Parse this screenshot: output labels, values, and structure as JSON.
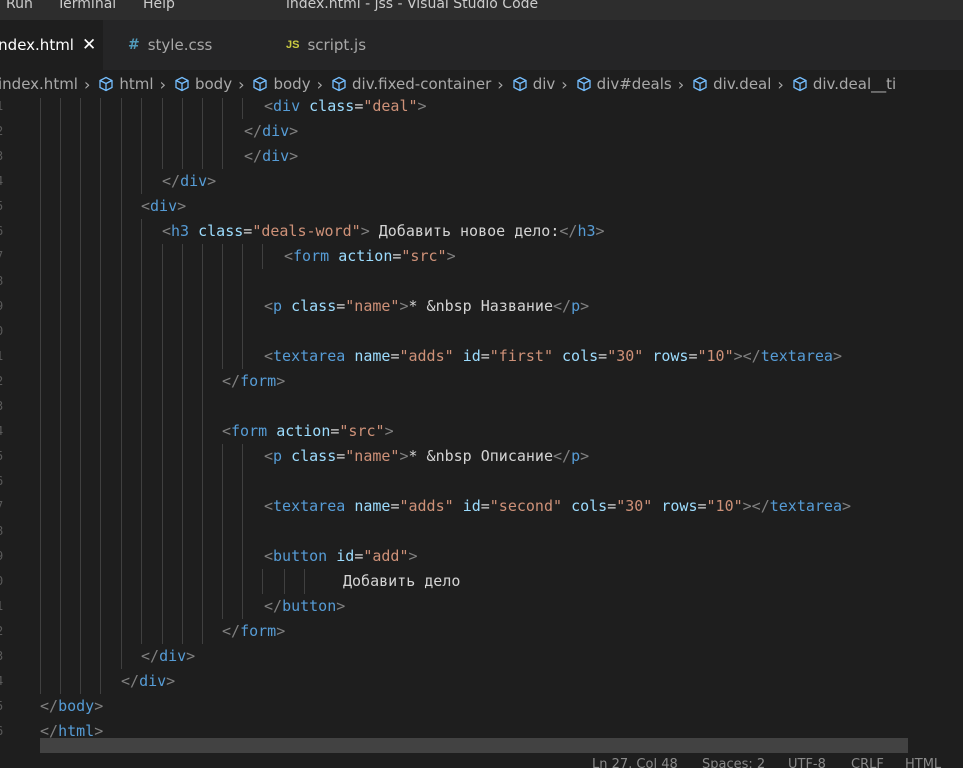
{
  "menu": {
    "run": "Run",
    "terminal": "Terminal",
    "help": "Help"
  },
  "window_title": "index.html - jss - Visual Studio Code",
  "tabs": [
    {
      "label": "index.html",
      "icon": "html-icon",
      "active": true
    },
    {
      "label": "style.css",
      "icon": "css-icon",
      "icon_text": "#"
    },
    {
      "label": "script.js",
      "icon": "js-icon",
      "icon_text": "JS"
    }
  ],
  "breadcrumb": [
    "index.html",
    "html",
    "body",
    "body",
    "div.fixed-container",
    "div",
    "div#deals",
    "div.deal",
    "div.deal__ti"
  ],
  "code": {
    "line_numbers": [
      "1",
      "2",
      "3",
      "4",
      "5",
      "6",
      "7",
      "8",
      "9",
      "0",
      "1",
      "2",
      "3",
      "4",
      "5",
      "6",
      "7",
      "8",
      "9",
      "0",
      "1",
      "2",
      "3",
      "4",
      "5",
      "6"
    ],
    "lines": [
      [
        [
          "p",
          "<"
        ],
        [
          "t",
          "div"
        ],
        [
          "x",
          " "
        ],
        [
          "a",
          "class"
        ],
        [
          "x",
          "="
        ],
        [
          "s",
          "\"deal\""
        ],
        [
          "p",
          ">"
        ]
      ],
      [
        [
          "p",
          "</"
        ],
        [
          "t",
          "div"
        ],
        [
          "p",
          ">"
        ]
      ],
      [
        [
          "p",
          "</"
        ],
        [
          "t",
          "div"
        ],
        [
          "p",
          ">"
        ]
      ],
      [
        [
          "p",
          "</"
        ],
        [
          "t",
          "div"
        ],
        [
          "p",
          ">"
        ]
      ],
      [
        [
          "p",
          "<"
        ],
        [
          "t",
          "div"
        ],
        [
          "p",
          ">"
        ]
      ],
      [
        [
          "p",
          "<"
        ],
        [
          "t",
          "h3"
        ],
        [
          "x",
          " "
        ],
        [
          "a",
          "class"
        ],
        [
          "x",
          "="
        ],
        [
          "s",
          "\"deals-word\""
        ],
        [
          "p",
          ">"
        ],
        [
          "x",
          " Добавить новое дело:"
        ],
        [
          "p",
          "</"
        ],
        [
          "t",
          "h3"
        ],
        [
          "p",
          ">"
        ]
      ],
      [
        [
          "p",
          "<"
        ],
        [
          "t",
          "form"
        ],
        [
          "x",
          " "
        ],
        [
          "a",
          "action"
        ],
        [
          "x",
          "="
        ],
        [
          "s",
          "\"src\""
        ],
        [
          "p",
          ">"
        ]
      ],
      [],
      [
        [
          "p",
          "<"
        ],
        [
          "t",
          "p"
        ],
        [
          "x",
          " "
        ],
        [
          "a",
          "class"
        ],
        [
          "x",
          "="
        ],
        [
          "s",
          "\"name\""
        ],
        [
          "p",
          ">"
        ],
        [
          "x",
          "* &nbsp Название"
        ],
        [
          "p",
          "</"
        ],
        [
          "t",
          "p"
        ],
        [
          "p",
          ">"
        ]
      ],
      [],
      [
        [
          "p",
          "<"
        ],
        [
          "t",
          "textarea"
        ],
        [
          "x",
          " "
        ],
        [
          "a",
          "name"
        ],
        [
          "x",
          "="
        ],
        [
          "s",
          "\"adds\""
        ],
        [
          "x",
          " "
        ],
        [
          "a",
          "id"
        ],
        [
          "x",
          "="
        ],
        [
          "s",
          "\"first\""
        ],
        [
          "x",
          " "
        ],
        [
          "a",
          "cols"
        ],
        [
          "x",
          "="
        ],
        [
          "s",
          "\"30\""
        ],
        [
          "x",
          " "
        ],
        [
          "a",
          "rows"
        ],
        [
          "x",
          "="
        ],
        [
          "s",
          "\"10\""
        ],
        [
          "p",
          "></"
        ],
        [
          "t",
          "textarea"
        ],
        [
          "p",
          ">"
        ]
      ],
      [
        [
          "p",
          "</"
        ],
        [
          "t",
          "form"
        ],
        [
          "p",
          ">"
        ]
      ],
      [],
      [
        [
          "p",
          "<"
        ],
        [
          "t",
          "form"
        ],
        [
          "x",
          " "
        ],
        [
          "a",
          "action"
        ],
        [
          "x",
          "="
        ],
        [
          "s",
          "\"src\""
        ],
        [
          "p",
          ">"
        ]
      ],
      [
        [
          "p",
          "<"
        ],
        [
          "t",
          "p"
        ],
        [
          "x",
          " "
        ],
        [
          "a",
          "class"
        ],
        [
          "x",
          "="
        ],
        [
          "s",
          "\"name\""
        ],
        [
          "p",
          ">"
        ],
        [
          "x",
          "* &nbsp Описание"
        ],
        [
          "p",
          "</"
        ],
        [
          "t",
          "p"
        ],
        [
          "p",
          ">"
        ]
      ],
      [],
      [
        [
          "p",
          "<"
        ],
        [
          "t",
          "textarea"
        ],
        [
          "x",
          " "
        ],
        [
          "a",
          "name"
        ],
        [
          "x",
          "="
        ],
        [
          "s",
          "\"adds\""
        ],
        [
          "x",
          " "
        ],
        [
          "a",
          "id"
        ],
        [
          "x",
          "="
        ],
        [
          "s",
          "\"second\""
        ],
        [
          "x",
          " "
        ],
        [
          "a",
          "cols"
        ],
        [
          "x",
          "="
        ],
        [
          "s",
          "\"30\""
        ],
        [
          "x",
          " "
        ],
        [
          "a",
          "rows"
        ],
        [
          "x",
          "="
        ],
        [
          "s",
          "\"10\""
        ],
        [
          "p",
          "></"
        ],
        [
          "t",
          "textarea"
        ],
        [
          "p",
          ">"
        ]
      ],
      [],
      [
        [
          "p",
          "<"
        ],
        [
          "t",
          "button"
        ],
        [
          "x",
          " "
        ],
        [
          "a",
          "id"
        ],
        [
          "x",
          "="
        ],
        [
          "s",
          "\"add\""
        ],
        [
          "p",
          ">"
        ]
      ],
      [
        [
          "x",
          "Добавить дело"
        ]
      ],
      [
        [
          "p",
          "</"
        ],
        [
          "t",
          "button"
        ],
        [
          "p",
          ">"
        ]
      ],
      [
        [
          "p",
          "</"
        ],
        [
          "t",
          "form"
        ],
        [
          "p",
          ">"
        ]
      ],
      [
        [
          "p",
          "</"
        ],
        [
          "t",
          "div"
        ],
        [
          "p",
          ">"
        ]
      ],
      [
        [
          "p",
          "</"
        ],
        [
          "t",
          "div"
        ],
        [
          "p",
          ">"
        ]
      ],
      [
        [
          "p",
          "</"
        ],
        [
          "t",
          "body"
        ],
        [
          "p",
          ">"
        ]
      ],
      [
        [
          "p",
          "</"
        ],
        [
          "t",
          "html"
        ],
        [
          "p",
          ">"
        ]
      ]
    ]
  },
  "status": [
    "Ln 27, Col 48",
    "Spaces: 2",
    "UTF-8",
    "CRLF",
    "HTML"
  ],
  "colors": {
    "tag": "#569cd6",
    "attr": "#9cdcfe",
    "string": "#ce9178",
    "punct": "#808080",
    "text": "#d4d4d4"
  }
}
